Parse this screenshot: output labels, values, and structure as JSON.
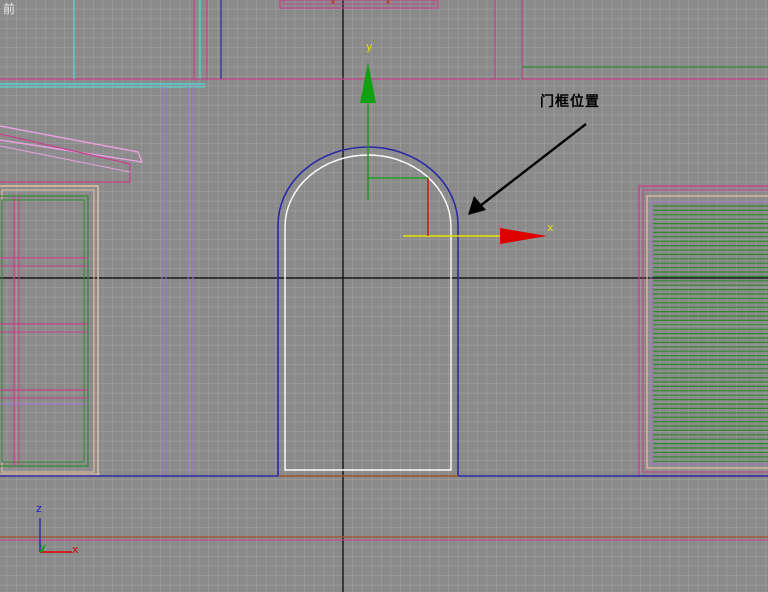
{
  "viewport": {
    "label": "前",
    "annotation": "门框位置"
  },
  "gizmo": {
    "y_label": "y",
    "x_label": "x"
  },
  "axis_tripod": {
    "z_label": "z",
    "y_label": "y",
    "x_label": "x"
  },
  "colors": {
    "background": "#8a8a8a",
    "grid_minor": "#9b9b9b",
    "grid_major": "#000000",
    "wall_outline": "#2a2aa8",
    "door_frame": "#ffffff",
    "window_green": "#2f8a2f",
    "trim_pink": "#c8408c",
    "trim_cyan": "#44e0e0",
    "trim_violet": "#a070d0",
    "trim_peach": "#e8c0a0",
    "floor_line": "#a0522d",
    "gizmo_x": "#dd0000",
    "gizmo_y": "#10a010",
    "gizmo_selected": "#e8e000"
  }
}
